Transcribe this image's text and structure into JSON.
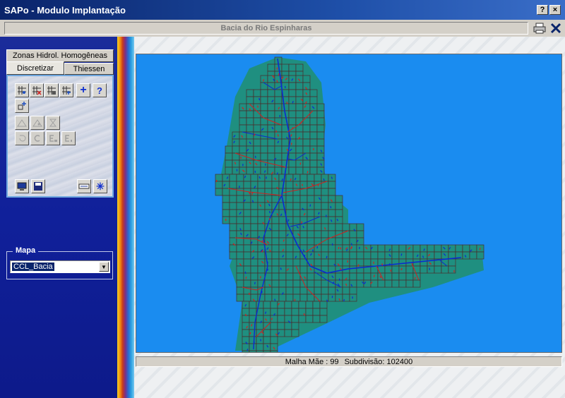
{
  "window": {
    "title": "SAPo - Modulo Implantação",
    "help_label": "?",
    "close_label": "×"
  },
  "header": {
    "subtitle": "Bacia do Rio Espinharas"
  },
  "tabs": {
    "zonas": "Zonas Hidrol. Homogêneas",
    "discretizar": "Discretizar",
    "thiessen": "Thiessen"
  },
  "tools": {
    "row1": [
      "grid-add-icon",
      "grid-remove-icon",
      "grid-select-icon",
      "grid-star-icon",
      "plus-icon",
      "help-icon"
    ],
    "plus_label": "+",
    "help_label": "?",
    "asterisk_label": "✳"
  },
  "mapa": {
    "label": "Mapa",
    "selected": "CCL_Bacia"
  },
  "status": {
    "malha_mae": "Malha Mãe : 99",
    "subdivisao": "Subdivisão: 102400"
  },
  "colors": {
    "map_background": "#1a8cf0",
    "basin_fill": "#1f8f80",
    "cell_border": "#4a2a2a",
    "river_blue": "#0a2ad0",
    "river_red": "#d02020"
  }
}
